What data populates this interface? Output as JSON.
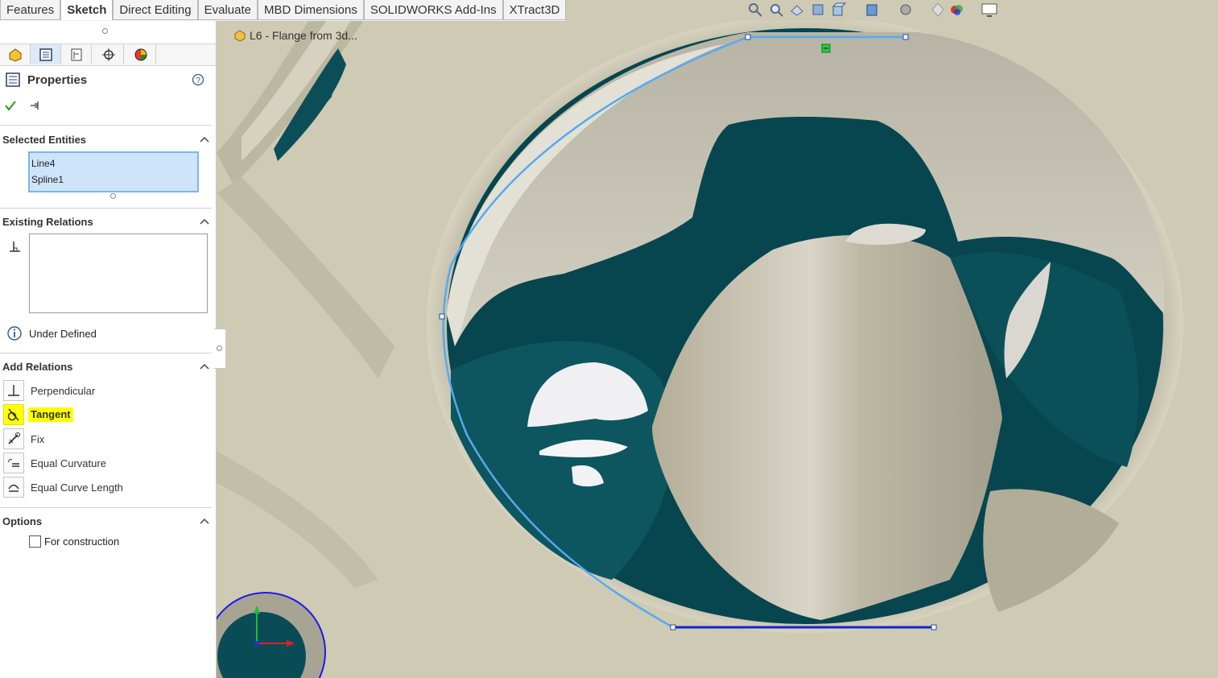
{
  "command_tabs": [
    "Features",
    "Sketch",
    "Direct Editing",
    "Evaluate",
    "MBD Dimensions",
    "SOLIDWORKS Add-Ins",
    "XTract3D"
  ],
  "document": {
    "title": "L6 - Flange from 3d..."
  },
  "property_manager": {
    "title": "Properties",
    "selected_entities": {
      "header": "Selected Entities",
      "items": [
        "Line4",
        "Spline1"
      ]
    },
    "existing_relations": {
      "header": "Existing Relations",
      "status": "Under Defined"
    },
    "add_relations": {
      "header": "Add Relations",
      "items": [
        {
          "label": "Perpendicular",
          "highlighted": false
        },
        {
          "label": "Tangent",
          "highlighted": true
        },
        {
          "label": "Fix",
          "highlighted": false
        },
        {
          "label": "Equal Curvature",
          "highlighted": false
        },
        {
          "label": "Equal Curve Length",
          "highlighted": false
        }
      ]
    },
    "options": {
      "header": "Options",
      "for_construction_label": "For construction",
      "for_construction_checked": false
    }
  },
  "colors": {
    "highlight": "#ffff00",
    "accent": "#55aaee",
    "check": "#3a9a3a",
    "model_surface": "#cfcab4",
    "cavity": "#07464f"
  },
  "icons": [
    "feature-manager-icon",
    "property-manager-icon",
    "configuration-manager-icon",
    "dimxpert-icon",
    "display-manager-icon",
    "zoom-to-fit-icon",
    "zoom-area-icon",
    "previous-view-icon",
    "section-view-icon",
    "view-orientation-icon",
    "display-style-icon",
    "hide-show-icon",
    "edit-appearance-icon",
    "apply-scene-icon",
    "view-settings-icon"
  ]
}
